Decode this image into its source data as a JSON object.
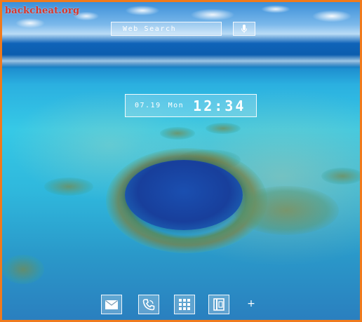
{
  "watermark": "backcheat.org",
  "search": {
    "label": "Web Search"
  },
  "clock": {
    "date": "07.19",
    "day": "Mon",
    "time": "12:34"
  },
  "dock": {
    "items": [
      {
        "icon": "mail-icon"
      },
      {
        "icon": "phone-icon"
      },
      {
        "icon": "app-drawer-grid-icon"
      },
      {
        "icon": "contacts-book-icon"
      }
    ],
    "add_label": "+"
  }
}
